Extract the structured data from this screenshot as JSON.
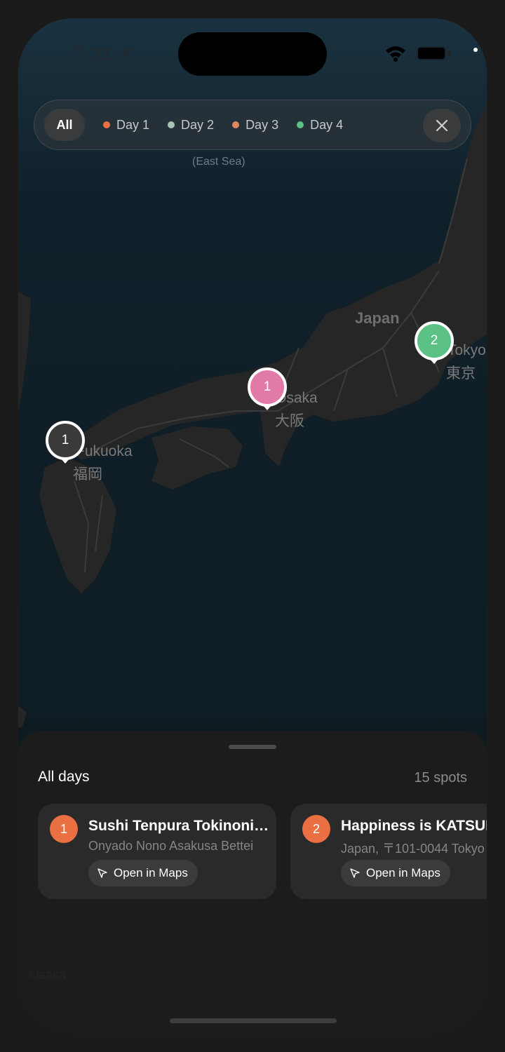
{
  "status_bar": {
    "time": "7:31"
  },
  "filters": {
    "all_label": "All",
    "days": [
      {
        "label": "Day 1",
        "color": "#ea7043"
      },
      {
        "label": "Day 2",
        "color": "#a7c4b5"
      },
      {
        "label": "Day 3",
        "color": "#e0875f"
      },
      {
        "label": "Day 4",
        "color": "#5cc184"
      }
    ]
  },
  "map": {
    "labels": {
      "sea": "(East Sea)",
      "country": "Japan",
      "tokyo_en": "Tokyo",
      "tokyo_jp": "東京",
      "osaka_en": "Osaka",
      "osaka_jp": "大阪",
      "fukuoka_en": "Fukuoka",
      "fukuoka_jp": "福岡"
    },
    "pins": [
      {
        "count": "1",
        "color": "#3a3a3a"
      },
      {
        "count": "1",
        "color": "#e17aa6"
      },
      {
        "count": "2",
        "color": "#5cc184"
      }
    ]
  },
  "sheet": {
    "title": "All days",
    "count": "15 spots",
    "cards": [
      {
        "number": "1",
        "name": "Sushi Tenpura Tokinoniwa",
        "address": "Onyado Nono Asakusa Bettei",
        "button": "Open in Maps"
      },
      {
        "number": "2",
        "name": "Happiness is KATSUDON",
        "address": "Japan, 〒101-0044 Tokyo",
        "button": "Open in Maps"
      }
    ],
    "ghost": "Osaka"
  }
}
